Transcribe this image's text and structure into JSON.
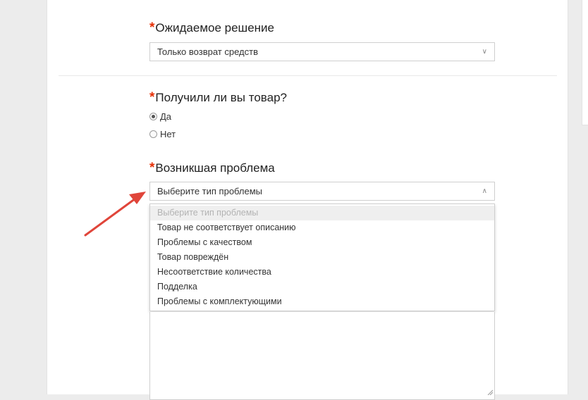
{
  "expected_solution": {
    "required_mark": "*",
    "label": "Ожидаемое решение",
    "value": "Только возврат средств"
  },
  "received_item": {
    "required_mark": "*",
    "label": "Получили ли вы товар?",
    "options": [
      "Да",
      "Нет"
    ],
    "selected": "Да"
  },
  "problem": {
    "required_mark": "*",
    "label": "Возникшая проблема",
    "value": "Выберите тип проблемы",
    "options": [
      "Выберите тип проблемы",
      "Товар не соответствует описанию",
      "Проблемы с качеством",
      "Товар повреждён",
      "Несоответствие количества",
      "Подделка",
      "Проблемы с комплектующими"
    ]
  },
  "colors": {
    "required": "#e62e04",
    "arrow": "#e0453a"
  }
}
